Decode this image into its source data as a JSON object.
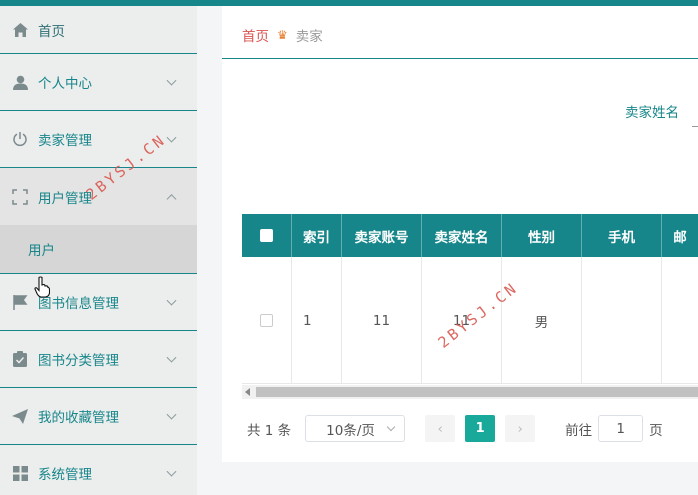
{
  "sidebar": {
    "items": [
      {
        "label": "首页",
        "icon": "home-icon"
      },
      {
        "label": "个人中心",
        "icon": "user-icon"
      },
      {
        "label": "卖家管理",
        "icon": "power-icon"
      },
      {
        "label": "用户管理",
        "icon": "frame-icon"
      },
      {
        "label": "图书信息管理",
        "icon": "flag-icon"
      },
      {
        "label": "图书分类管理",
        "icon": "clipboard-icon"
      },
      {
        "label": "我的收藏管理",
        "icon": "send-icon"
      },
      {
        "label": "系统管理",
        "icon": "grid-icon"
      }
    ],
    "submenu": {
      "label": "用户"
    }
  },
  "breadcrumb": {
    "home": "首页",
    "current": "卖家"
  },
  "search": {
    "label": "卖家姓名"
  },
  "table": {
    "headers": [
      "索引",
      "卖家账号",
      "卖家姓名",
      "性别",
      "手机",
      "邮"
    ],
    "rows": [
      {
        "index": "1",
        "account": "11",
        "name": "11",
        "gender": "男",
        "phone": "",
        "email": ""
      }
    ]
  },
  "pagination": {
    "total": "共 1 条",
    "page_size": "10条/页",
    "current_page": "1",
    "goto_prefix": "前往",
    "goto_value": "1",
    "goto_suffix": "页"
  },
  "watermark": "2BYSJ.CN",
  "colors": {
    "primary": "#17868a",
    "active_page": "#18a99a",
    "home_crumb": "#d9534f"
  }
}
